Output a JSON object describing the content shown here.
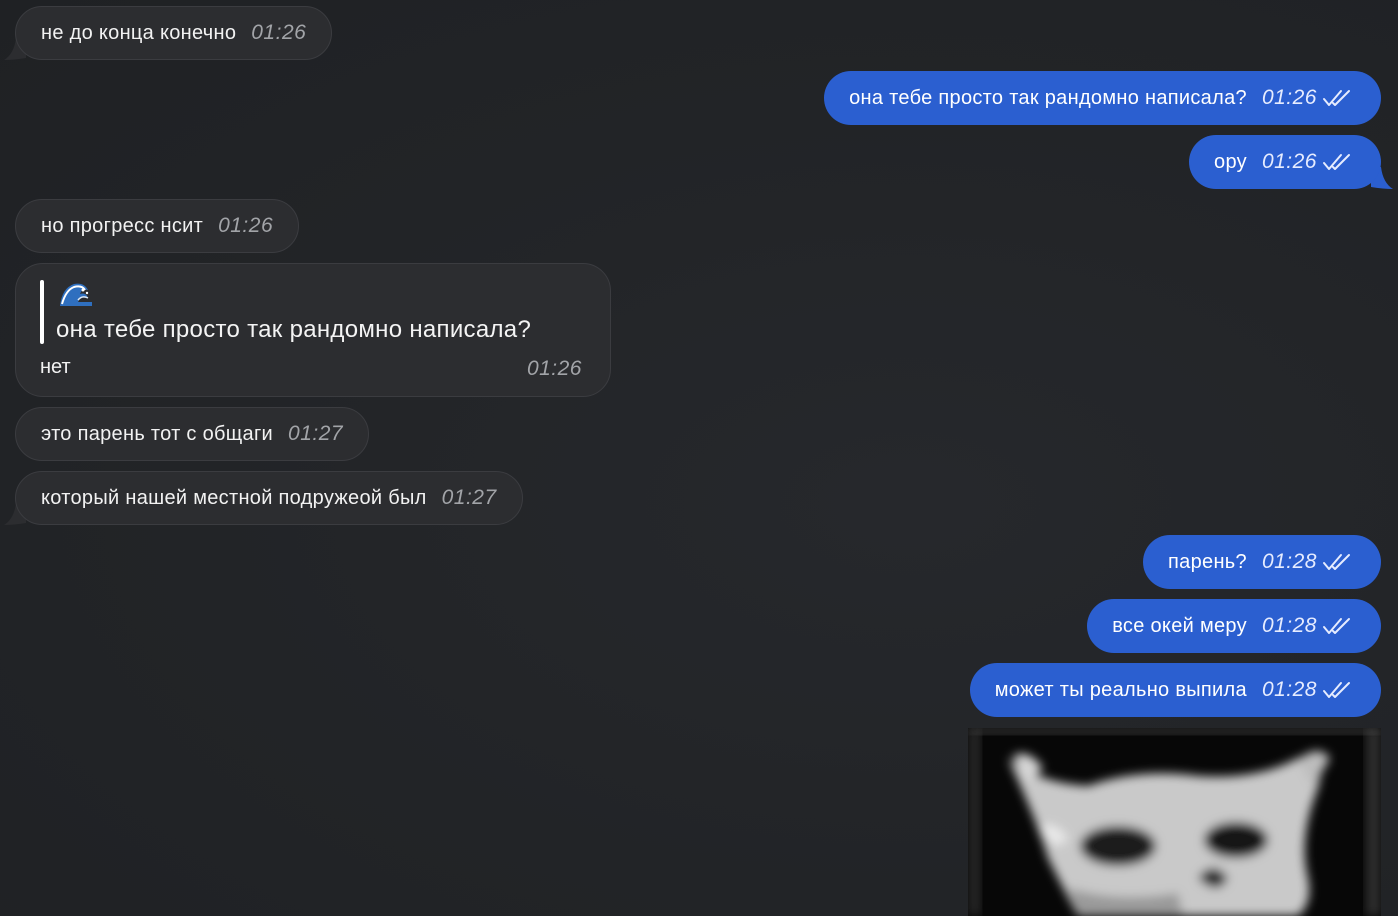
{
  "messages": [
    {
      "text": "не до конца конечно",
      "time": "01:26"
    },
    {
      "text": "она тебе просто так рандомно написала?",
      "time": "01:26"
    },
    {
      "text": "ору",
      "time": "01:26"
    },
    {
      "text": "но прогресс нсит",
      "time": "01:26"
    },
    {
      "quote_emoji": "water-wave-emoji",
      "quote_text": "она тебе просто так рандомно написала?",
      "text": "нет",
      "time": "01:26"
    },
    {
      "text": "это парень тот с общаги",
      "time": "01:27"
    },
    {
      "text": "который нашей местной подружеой был",
      "time": "01:27"
    },
    {
      "text": "парень?",
      "time": "01:28"
    },
    {
      "text": "все окей меру",
      "time": "01:28"
    },
    {
      "text": "может ты реально выпила",
      "time": "01:28"
    }
  ],
  "icons": {
    "read_receipt": "double-check-icon",
    "photo": "dark-blurry-photo"
  },
  "colors": {
    "background": "#222427",
    "incoming_bubble": "#2c2d30",
    "outgoing_bubble": "#2b5fd0"
  }
}
